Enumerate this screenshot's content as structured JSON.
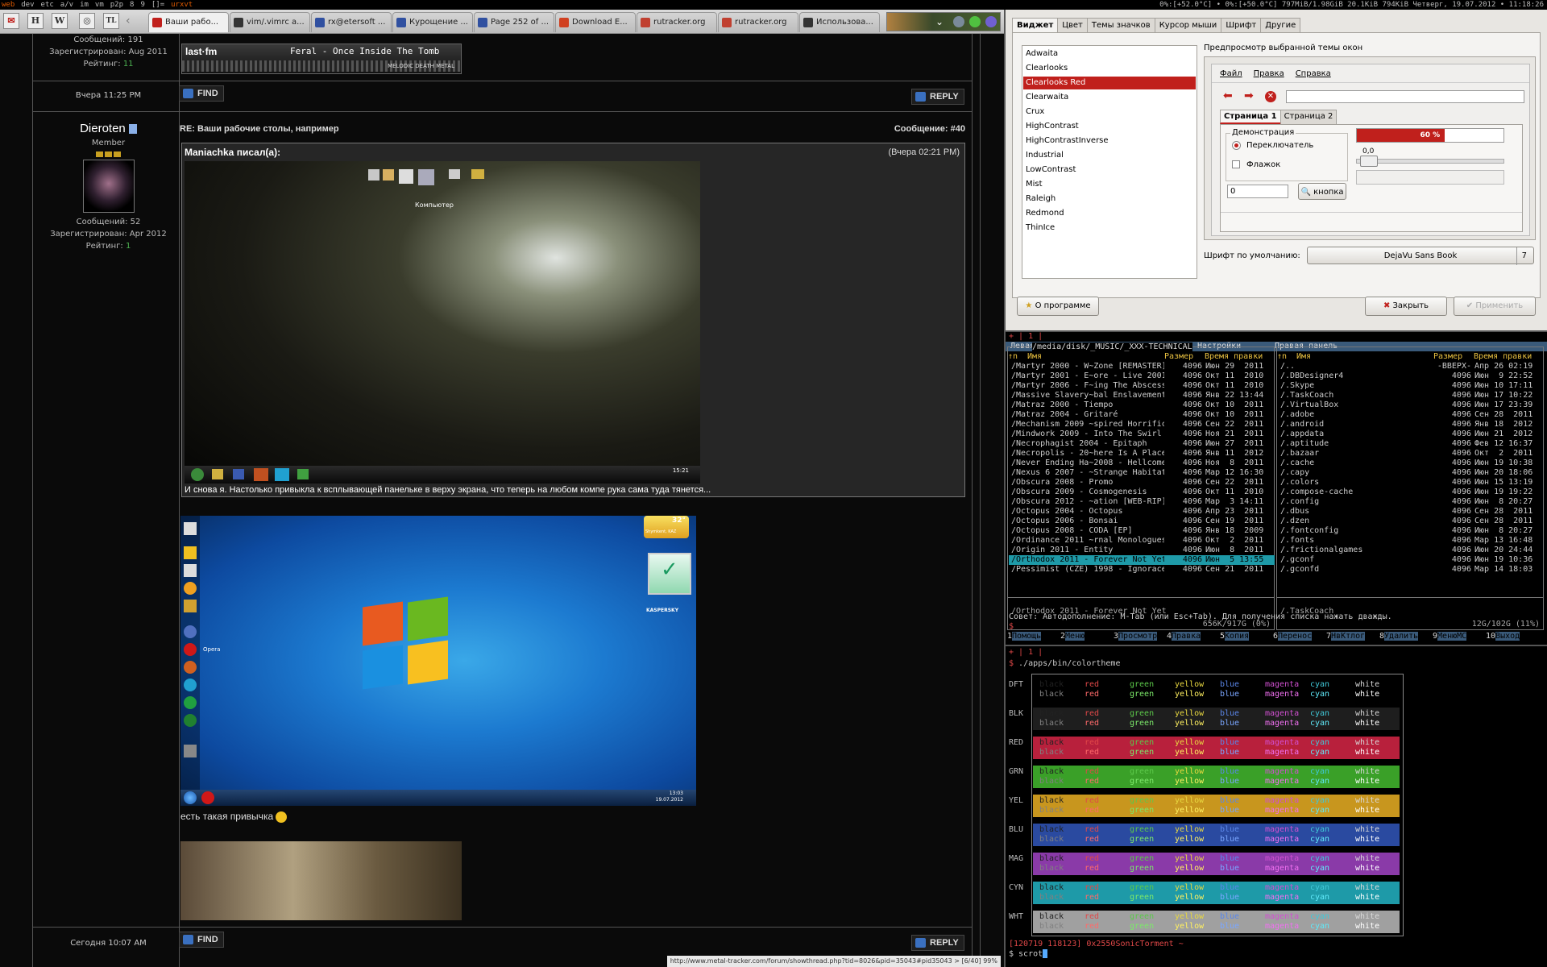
{
  "topbar": {
    "tags": [
      "web",
      "dev",
      "etc",
      "a/v",
      "im",
      "vm",
      "p2p",
      "8",
      "9",
      "[]=",
      "urxvt"
    ],
    "status": "0%:[+52.0°C] • 0%:[+50.0°C]   797MiB/1.98GiB   20.1KiB   794KiB   Четверг, 19.07.2012 • 11:18:26"
  },
  "browser": {
    "app_icons": [
      "✉",
      "H",
      "W",
      "◎",
      "TL"
    ],
    "tabs": [
      {
        "label": "Ваши рабо...",
        "color": "#c0201c"
      },
      {
        "label": "vim/.vimrc a...",
        "color": "#333"
      },
      {
        "label": "rx@etersoft ...",
        "color": "#3050a0"
      },
      {
        "label": "Курощение ...",
        "color": "#3050a0"
      },
      {
        "label": "Page 252 of ...",
        "color": "#3050a0"
      },
      {
        "label": "Download E...",
        "color": "#d04020"
      },
      {
        "label": "rutracker.org",
        "color": "#c04030"
      },
      {
        "label": "rutracker.org",
        "color": "#c04030"
      },
      {
        "label": "Использова...",
        "color": "#333"
      }
    ],
    "statusurl": "http://www.metal-tracker.com/forum/showthread.php?tid=8026&pid=35043#pid35043 > [6/40] 99%"
  },
  "forum": {
    "prev": {
      "messages": "Сообщений: 191",
      "registered": "Зарегистрирован: Aug 2011",
      "rating_label": "Рейтинг:",
      "rating": "11",
      "signature": "Feral - Once Inside The Tomb",
      "signature_sub": "MELODIC DEATH METAL",
      "lastfm": "last·fm",
      "date": "Вчера 11:25 PM",
      "find": "FIND",
      "reply": "REPLY"
    },
    "post": {
      "user": "Dieroten",
      "rank": "Member",
      "messages": "Сообщений: 52",
      "registered": "Зарегистрирован: Apr 2012",
      "rating_label": "Рейтинг:",
      "rating": "1",
      "title": "RE: Ваши рабочие столы, например",
      "number_label": "Сообщение:",
      "number": "#40",
      "quote_author": "Maniachka писал(а):",
      "quote_date": "(Вчера 02:21 PM)",
      "quote_text": "И снова я. Настолько привыкла к всплывающей панельке в верху экрана, что теперь на любом компе рука сама туда тянется...",
      "desktop_label": "Компьютер",
      "desktop_time": "15:21",
      "text": "есть такая привычка",
      "date": "Сегодня 10:07 AM",
      "find": "FIND",
      "reply": "REPLY"
    },
    "win7": {
      "temp": "32°",
      "weather": "Shymkent, KAZ",
      "kaspersky": "KASPERSKY",
      "opera": "Opera",
      "time": "13:03",
      "date": "19.07.2012"
    }
  },
  "gtk": {
    "tabs": [
      "Виджет",
      "Цвет",
      "Темы значков",
      "Курсор мыши",
      "Шрифт",
      "Другие"
    ],
    "themes": [
      "Adwaita",
      "Clearlooks",
      "Clearlooks Red",
      "Clearwaita",
      "Crux",
      "HighContrast",
      "HighContrastInverse",
      "Industrial",
      "LowContrast",
      "Mist",
      "Raleigh",
      "Redmond",
      "ThinIce"
    ],
    "selected": "Clearlooks Red",
    "accent": "#c0201c",
    "preview_label": "Предпросмотр выбранной темы окон",
    "menu": [
      "Файл",
      "Правка",
      "Справка"
    ],
    "page_tabs": [
      "Страница 1",
      "Страница 2"
    ],
    "demo_label": "Демонстрация",
    "radio": "Переключатель",
    "check": "Флажок",
    "spin_value": "0",
    "search_btn": "кнопка",
    "progress": 0.6,
    "progress_text": "60 %",
    "slider_value": "0,0",
    "font_label": "Шрифт по умолчанию:",
    "font_value": "DejaVu Sans Book",
    "font_size": "7",
    "about": "О программе",
    "close": "Закрыть",
    "apply": "Применить"
  },
  "mc": {
    "header": "+ | 1 |",
    "menu": [
      "Левая панель",
      "Файл",
      "Команда",
      "Настройки",
      "Правая панель"
    ],
    "lpath": " /media/disk/_MUSIC/_XXX-TECHNICAL ",
    "cols_left": [
      "↑n",
      "Имя",
      "Размер",
      "Время правки"
    ],
    "cols_right": [
      "↑n",
      "Имя",
      "Размер",
      "Время правки"
    ],
    "left": [
      [
        "/Martyr 2000 - W~Zone [REMASTER]",
        "4096",
        "Июн 29  2011"
      ],
      [
        "/Martyr 2001 - E~ore - Live 2001",
        "4096",
        "Окт 11  2010"
      ],
      [
        "/Martyr 2006 - F~ing The Abscess",
        "4096",
        "Окт 11  2010"
      ],
      [
        "/Massive Slavery~bal Enslavement",
        "4096",
        "Янв 22 13:44"
      ],
      [
        "/Matraz 2000 - Tiempo",
        "4096",
        "Окт 10  2011"
      ],
      [
        "/Matraz 2004 - Gritaré",
        "4096",
        "Окт 10  2011"
      ],
      [
        "/Mechanism 2009 ~spired Horrific",
        "4096",
        "Сен 22  2011"
      ],
      [
        "/Mindwork 2009 - Into The Swirl",
        "4096",
        "Ноя 21  2011"
      ],
      [
        "/Necrophagist 2004 - Epitaph",
        "4096",
        "Июн 27  2011"
      ],
      [
        "/Necropolis - 20~here Is A Place",
        "4096",
        "Янв 11  2012"
      ],
      [
        "/Never Ending Ha~2008 - Hellcome",
        "4096",
        "Ноя  8  2011"
      ],
      [
        "/Nexus 6 2007 - ~Strange Habitat",
        "4096",
        "Мар 12 16:30"
      ],
      [
        "/Obscura 2008 - Promo",
        "4096",
        "Сен 22  2011"
      ],
      [
        "/Obscura 2009 - Cosmogenesis",
        "4096",
        "Окт 11  2010"
      ],
      [
        "/Obscura 2012 - ~ation [WEB-RIP]",
        "4096",
        "Мар  3 14:11"
      ],
      [
        "/Octopus 2004 - Octopus",
        "4096",
        "Апр 23  2011"
      ],
      [
        "/Octopus 2006 - Bonsai",
        "4096",
        "Сен 19  2011"
      ],
      [
        "/Octopus 2008 - CODA [EP]",
        "4096",
        "Янв 18  2009"
      ],
      [
        "/Ordinance 2011 ~rnal Monologues",
        "4096",
        "Окт  2  2011"
      ],
      [
        "/Origin 2011 - Entity",
        "4096",
        "Июн  8  2011"
      ],
      [
        "/Orthodox 2011 - Forever Not Yet",
        "4096",
        "Июн  5 13:55"
      ],
      [
        "/Pessimist (CZE) 1998 - Ignorace",
        "4096",
        "Сен 21  2011"
      ]
    ],
    "right": [
      [
        "/..",
        "-ВВЕРХ-",
        "Апр 26 02:19"
      ],
      [
        "/.DBDesigner4",
        "4096",
        "Июн  9 22:52"
      ],
      [
        "/.Skype",
        "4096",
        "Июн 10 17:11"
      ],
      [
        "/.TaskCoach",
        "4096",
        "Июн 17 10:22"
      ],
      [
        "/.VirtualBox",
        "4096",
        "Июн 17 23:39"
      ],
      [
        "/.adobe",
        "4096",
        "Сен 28  2011"
      ],
      [
        "/.android",
        "4096",
        "Янв 18  2012"
      ],
      [
        "/.appdata",
        "4096",
        "Июн 21  2012"
      ],
      [
        "/.aptitude",
        "4096",
        "Фев 12 16:37"
      ],
      [
        "/.bazaar",
        "4096",
        "Окт  2  2011"
      ],
      [
        "/.cache",
        "4096",
        "Июн 19 10:38"
      ],
      [
        "/.capy",
        "4096",
        "Июн 20 18:06"
      ],
      [
        "/.colors",
        "4096",
        "Июн 15 13:19"
      ],
      [
        "/.compose-cache",
        "4096",
        "Июн 19 19:22"
      ],
      [
        "/.config",
        "4096",
        "Июн  8 20:27"
      ],
      [
        "/.dbus",
        "4096",
        "Сен 28  2011"
      ],
      [
        "/.dzen",
        "4096",
        "Сен 28  2011"
      ],
      [
        "/.fontconfig",
        "4096",
        "Июн  8 20:27"
      ],
      [
        "/.fonts",
        "4096",
        "Мар 13 16:48"
      ],
      [
        "/.frictionalgames",
        "4096",
        "Июн 20 24:44"
      ],
      [
        "/.gconf",
        "4096",
        "Июн 19 10:36"
      ],
      [
        "/.gconfd",
        "4096",
        "Мар 14 18:03"
      ]
    ],
    "selected_index": 20,
    "lstatus": "/Orthodox 2011 - Forever Not Yet",
    "lusage": "656K/917G (0%)",
    "rstatus": "/.TaskCoach",
    "rusage": "12G/102G (11%)",
    "hint": "Совет: Автодополнение: M-Tab (или Esc+Tab). Для получения списка нажать дважды.",
    "prompt": "$",
    "fkeys": [
      "1Помощь",
      "2Меню",
      "3Просмотр",
      "4Правка",
      "5Копия",
      "6Перенос",
      "7НвКтлог",
      "8Удалить",
      "9МенюMC",
      "10Выход"
    ]
  },
  "term": {
    "header": "+ | 1 |",
    "cmd": "./apps/bin/colortheme",
    "names": [
      "black",
      "red",
      "green",
      "yellow",
      "blue",
      "magenta",
      "cyan",
      "white"
    ],
    "rows": [
      {
        "label": "DFT",
        "bg": "#000000"
      },
      {
        "label": "BLK",
        "bg": "#1e1e1e"
      },
      {
        "label": "RED",
        "bg": "#b8203c"
      },
      {
        "label": "GRN",
        "bg": "#3aa028"
      },
      {
        "label": "YEL",
        "bg": "#c8961e"
      },
      {
        "label": "BLU",
        "bg": "#2a4aa0"
      },
      {
        "label": "MAG",
        "bg": "#8a3aa8"
      },
      {
        "label": "CYN",
        "bg": "#1e9aa8"
      },
      {
        "label": "WHT",
        "bg": "#a0a0a0"
      }
    ],
    "fg": [
      "#222222",
      "#e04848",
      "#5cc84a",
      "#e8d840",
      "#5a86e8",
      "#d050d0",
      "#40c8d8",
      "#d8d8d8"
    ],
    "fg_bright": [
      "#808080",
      "#ff6a6a",
      "#7ce86a",
      "#fff060",
      "#7aa6ff",
      "#f070f0",
      "#60e8f8",
      "#ffffff"
    ],
    "prompt_info": "[120719 118123] 0x2550SonicTorment ~",
    "last": "$ scrot"
  }
}
